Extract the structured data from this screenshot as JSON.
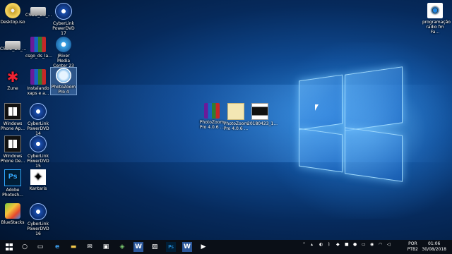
{
  "desktop": {
    "icons": [
      {
        "label": "Desktop.iso"
      },
      {
        "label": "CSGO_DS_..."
      },
      {
        "label": "CyberLink PowerDVD 17"
      },
      {
        "label": "CSGO_DS_..."
      },
      {
        "label": "csgo_ds_la..."
      },
      {
        "label": "JRiver Media Center 23"
      },
      {
        "label": "Zune"
      },
      {
        "label": "Instalando xaps e a..."
      },
      {
        "label": "PhotoZoom Pro 4"
      },
      {
        "label": "Windows Phone Ap..."
      },
      {
        "label": "CyberLink PowerDVD 14"
      },
      {
        "label": "Windows Phone De..."
      },
      {
        "label": "CyberLink PowerDVD 15"
      },
      {
        "label": "Adobe Photosh..."
      },
      {
        "label": "Kantaris"
      },
      {
        "label": "BlueStacks"
      },
      {
        "label": "CyberLink PowerDVD 16"
      },
      {
        "label": "PhotoZoom Pro 4.0.6 ..."
      },
      {
        "label": "PhotoZoom Pro 4.0.6 ..."
      },
      {
        "label": "20180423_1..."
      },
      {
        "label": "programação radio fm Fa..."
      }
    ]
  },
  "taskbar": {
    "start_icon": "windows-logo",
    "pinned": [
      "search-icon",
      "task-view-icon",
      "edge-icon",
      "file-explorer-icon",
      "mail-icon",
      "store-icon",
      "shield-icon",
      "word-icon",
      "photos-icon",
      "photoshop-icon",
      "word-icon",
      "media-player-icon"
    ],
    "tray": {
      "language_line1": "POR",
      "language_line2": "PTB2",
      "time": "01:06",
      "date": "30/08/2018"
    }
  },
  "colors": {
    "wallpaper_accent": "#2a7fd0",
    "taskbar": "#0a0f17"
  }
}
